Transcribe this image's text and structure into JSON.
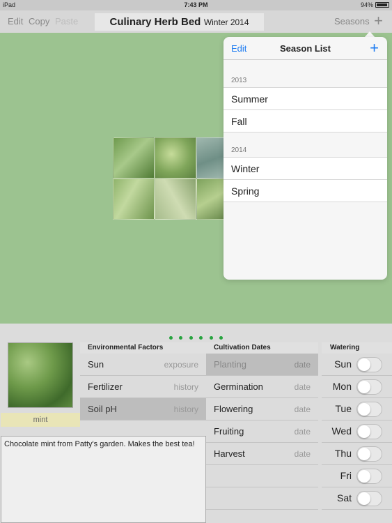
{
  "status_bar": {
    "device": "iPad",
    "time": "7:43 PM",
    "battery": "94%"
  },
  "toolbar": {
    "edit_label": "Edit",
    "copy_label": "Copy",
    "paste_label": "Paste",
    "title": "Culinary Herb Bed",
    "subtitle": "Winter 2014",
    "seasons_label": "Seasons",
    "add_icon": "plus-icon"
  },
  "popover": {
    "edit_label": "Edit",
    "title": "Season List",
    "add_icon": "plus-icon",
    "sections": [
      {
        "year": "2013",
        "seasons": [
          "Summer",
          "Fall"
        ]
      },
      {
        "year": "2014",
        "seasons": [
          "Winter",
          "Spring"
        ]
      }
    ]
  },
  "page_dots": {
    "count": 6
  },
  "plant": {
    "name": "mint",
    "notes": "Chocolate mint from Patty's garden. Makes the best tea!"
  },
  "environmental": {
    "header": "Environmental Factors",
    "rows": [
      {
        "label": "Sun",
        "value": "exposure",
        "selected": false
      },
      {
        "label": "Fertilizer",
        "value": "history",
        "selected": false
      },
      {
        "label": "Soil pH",
        "value": "history",
        "selected": true
      }
    ]
  },
  "cultivation": {
    "header": "Cultivation Dates",
    "rows": [
      {
        "label": "Planting",
        "value": "date",
        "selected": true
      },
      {
        "label": "Germination",
        "value": "date",
        "selected": false
      },
      {
        "label": "Flowering",
        "value": "date",
        "selected": false
      },
      {
        "label": "Fruiting",
        "value": "date",
        "selected": false
      },
      {
        "label": "Harvest",
        "value": "date",
        "selected": false
      }
    ]
  },
  "watering": {
    "header": "Watering",
    "days": [
      {
        "label": "Sun",
        "on": false
      },
      {
        "label": "Mon",
        "on": false
      },
      {
        "label": "Tue",
        "on": false
      },
      {
        "label": "Wed",
        "on": false
      },
      {
        "label": "Thu",
        "on": false
      },
      {
        "label": "Fri",
        "on": false
      },
      {
        "label": "Sat",
        "on": false
      }
    ]
  },
  "colors": {
    "garden_bg": "#9cc390",
    "accent_blue": "#1e7cf1",
    "dot_green": "#27a33f",
    "plant_label_bg": "#e9e5b7"
  }
}
